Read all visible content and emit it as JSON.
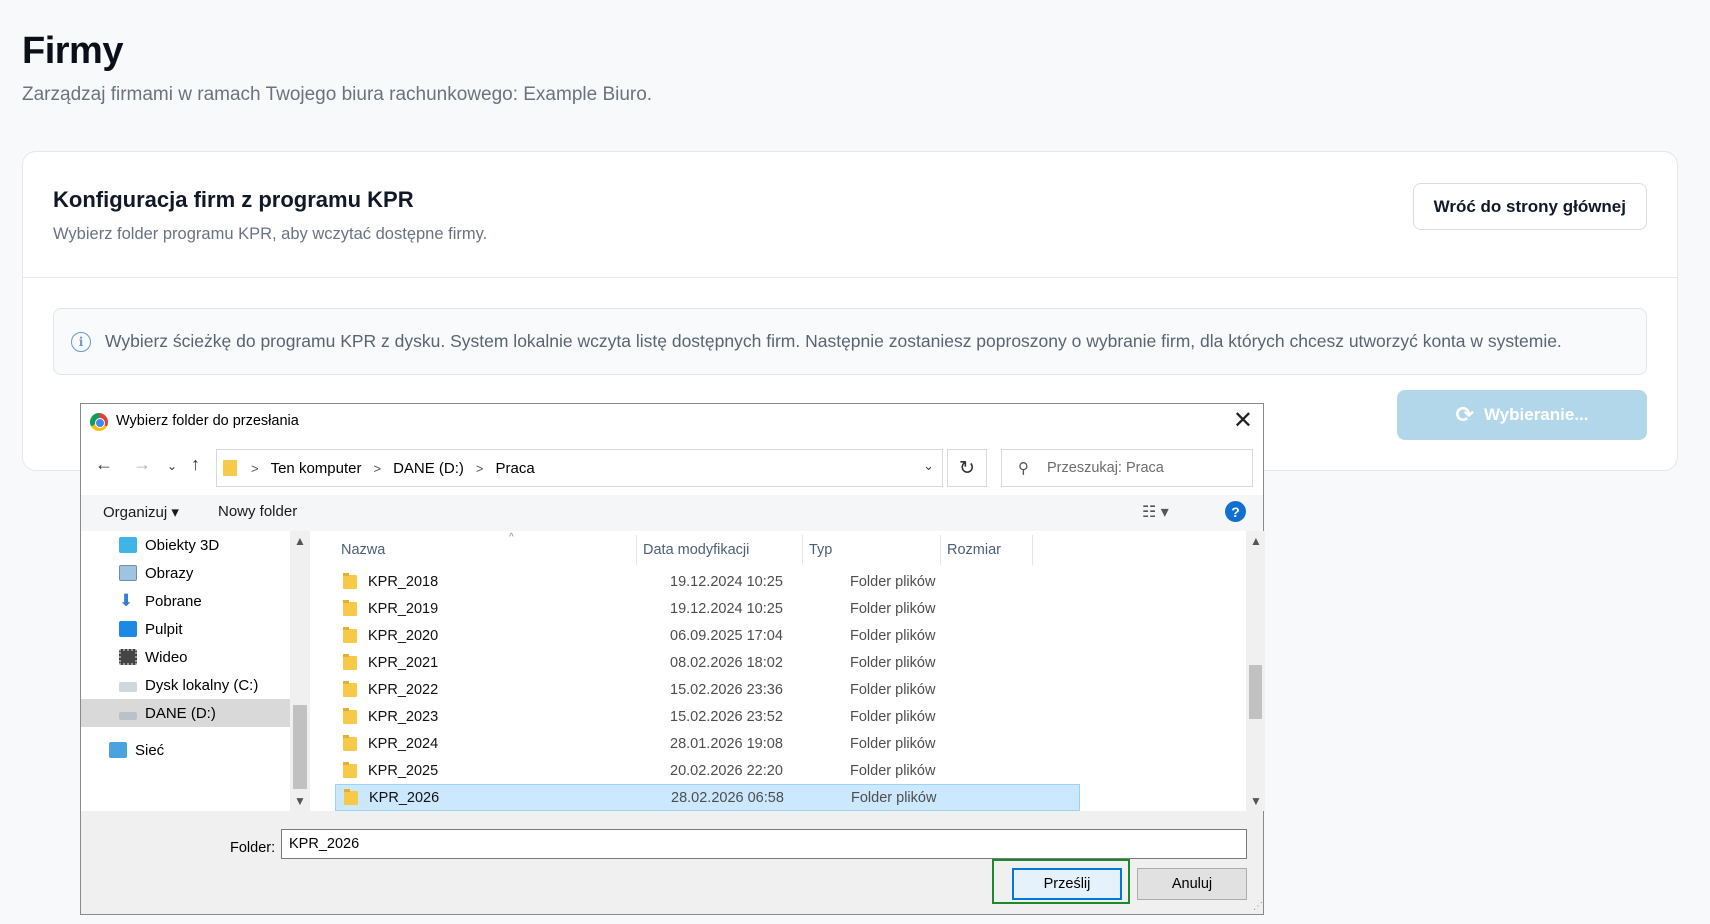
{
  "page": {
    "title": "Firmy",
    "subtitle": "Zarządzaj firmami w ramach Twojego biura rachunkowego: Example Biuro."
  },
  "card": {
    "title": "Konfiguracja firm z programu KPR",
    "subtitle": "Wybierz folder programu KPR, aby wczytać dostępne firmy.",
    "back_button": "Wróć do strony głównej",
    "info_icon": "ⓘ",
    "info_text": "Wybierz ścieżkę do programu KPR z dysku. System lokalnie wczyta listę dostępnych firm. Następnie zostaniesz poproszony o wybranie firm, dla których chcesz utworzyć konta w systemie.",
    "select_button": "Wybieranie...",
    "select_button_color": "#b3d7ea"
  },
  "dialog": {
    "title": "Wybierz folder do przesłania",
    "close": "✕",
    "address": [
      "Ten komputer",
      "DANE (D:)",
      "Praca"
    ],
    "search_placeholder": "Przeszukaj: Praca",
    "toolbar": {
      "organize": "Organizuj ▾",
      "new_folder": "Nowy folder",
      "help": "?"
    },
    "nav_items": [
      {
        "label": "Obiekty 3D",
        "icon": "cube-icon"
      },
      {
        "label": "Obrazy",
        "icon": "pictures-icon"
      },
      {
        "label": "Pobrane",
        "icon": "download-icon"
      },
      {
        "label": "Pulpit",
        "icon": "desktop-icon"
      },
      {
        "label": "Wideo",
        "icon": "video-icon"
      },
      {
        "label": "Dysk lokalny (C:)",
        "icon": "drive-icon"
      },
      {
        "label": "DANE (D:)",
        "icon": "drive-icon"
      },
      {
        "label": "Sieć",
        "icon": "network-icon"
      }
    ],
    "columns": [
      "Nazwa",
      "Data modyfikacji",
      "Typ",
      "Rozmiar"
    ],
    "rows": [
      {
        "name": "KPR_2018",
        "date": "19.12.2024 10:25",
        "type": "Folder plików"
      },
      {
        "name": "KPR_2019",
        "date": "19.12.2024 10:25",
        "type": "Folder plików"
      },
      {
        "name": "KPR_2020",
        "date": "06.09.2025 17:04",
        "type": "Folder plików"
      },
      {
        "name": "KPR_2021",
        "date": "08.02.2026 18:02",
        "type": "Folder plików"
      },
      {
        "name": "KPR_2022",
        "date": "15.02.2026 23:36",
        "type": "Folder plików"
      },
      {
        "name": "KPR_2023",
        "date": "15.02.2026 23:52",
        "type": "Folder plików"
      },
      {
        "name": "KPR_2024",
        "date": "28.01.2026 19:08",
        "type": "Folder plików"
      },
      {
        "name": "KPR_2025",
        "date": "20.02.2026 22:20",
        "type": "Folder plików"
      },
      {
        "name": "KPR_2026",
        "date": "28.02.2026 06:58",
        "type": "Folder plików"
      }
    ],
    "folder_label": "Folder:",
    "folder_value": "KPR_2026",
    "upload_button": "Prześlij",
    "cancel_button": "Anuluj"
  }
}
